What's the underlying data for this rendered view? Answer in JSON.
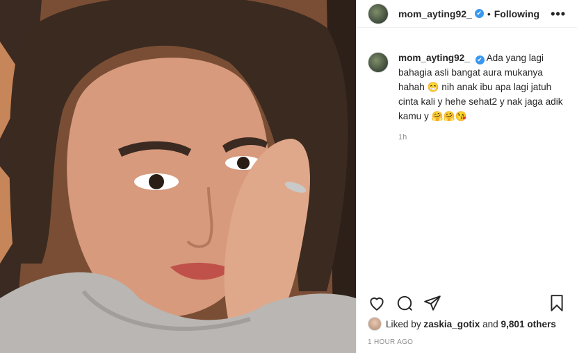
{
  "post": {
    "username": "mom_ayting92_",
    "verified_mark": "✔",
    "separator": "•",
    "follow_label": "Following",
    "more_label": "•••",
    "caption_user": "mom_ayting92_",
    "caption_text": "Ada yang lagi bahagia asli bangat aura mukanya hahah 😁 nih anak ibu apa lagi jatuh cinta kali y hehe sehat2 y nak jaga adik kamu y 🤗🤗😘",
    "caption_time": "1h",
    "likes_prefix": "Liked by",
    "likes_user": "zaskia_gotix",
    "likes_and": "and",
    "likes_count": "9,801 others",
    "posted_ago": "1 HOUR AGO"
  },
  "icons": [
    "heart-icon",
    "comment-icon",
    "share-icon",
    "bookmark-icon",
    "verified-icon",
    "more-icon"
  ],
  "colors": {
    "verified": "#3897f0",
    "text": "#262626",
    "muted": "#8e8e8e",
    "border": "#efefef"
  }
}
